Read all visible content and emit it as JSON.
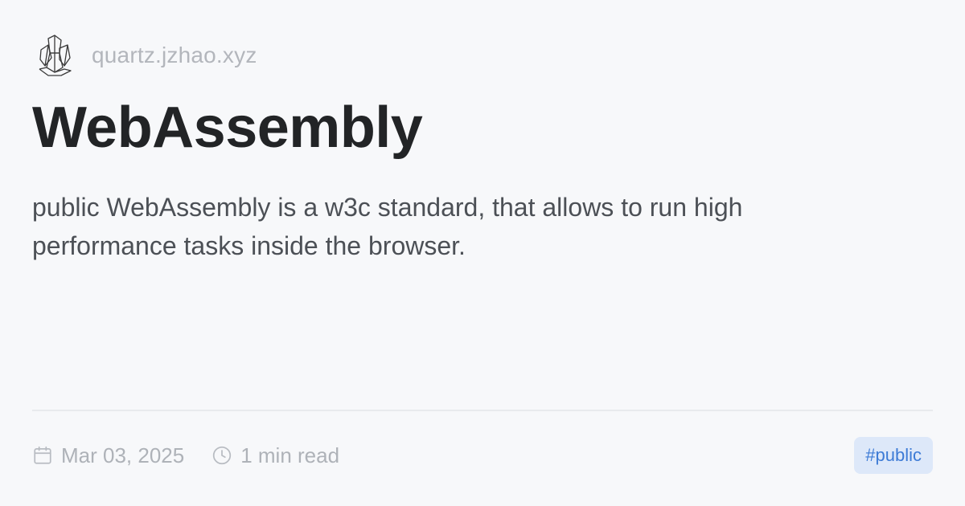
{
  "site": {
    "logo_icon": "crystal-logo-icon",
    "name": "quartz.jzhao.xyz"
  },
  "article": {
    "title": "WebAssembly",
    "description": "public WebAssembly is a w3c standard, that allows to run high performance tasks inside the browser."
  },
  "footer": {
    "date_icon": "calendar-icon",
    "date": "Mar 03, 2025",
    "reading_time_icon": "clock-icon",
    "reading_time": "1 min read",
    "tag": "#public"
  },
  "colors": {
    "background": "#f7f8fa",
    "title": "#222426",
    "body_text": "#4c5056",
    "muted_text": "#aeb2b8",
    "tag_background": "#dde8f9",
    "tag_text": "#3d7bd6"
  }
}
